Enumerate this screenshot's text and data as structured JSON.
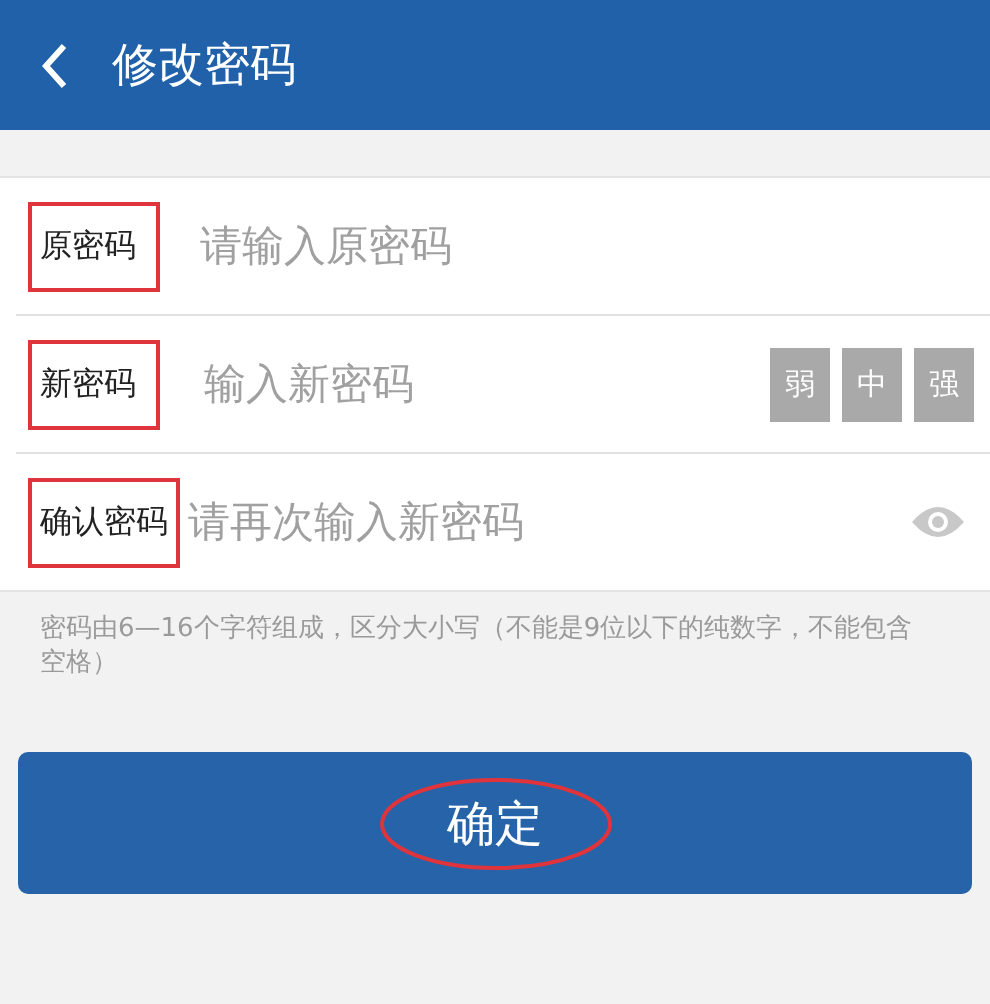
{
  "header": {
    "title": "修改密码"
  },
  "fields": [
    {
      "kind": "plain",
      "label": "原密码",
      "placeholder": "请输入原密码",
      "highlighted": true
    },
    {
      "kind": "strength",
      "label": "新密码",
      "placeholder": "输入新密码",
      "highlighted": true,
      "strength": [
        {
          "label": "弱",
          "active": false
        },
        {
          "label": "中",
          "active": false
        },
        {
          "label": "强",
          "active": false
        }
      ]
    },
    {
      "kind": "reveal",
      "label": "确认密码",
      "placeholder": "请再次输入新密码",
      "highlighted": true
    }
  ],
  "hint": "密码由6—16个字符组成，区分大小写（不能是9位以下的纯数字，不能包含空格）",
  "submit": {
    "label": "确定",
    "highlighted": true
  }
}
